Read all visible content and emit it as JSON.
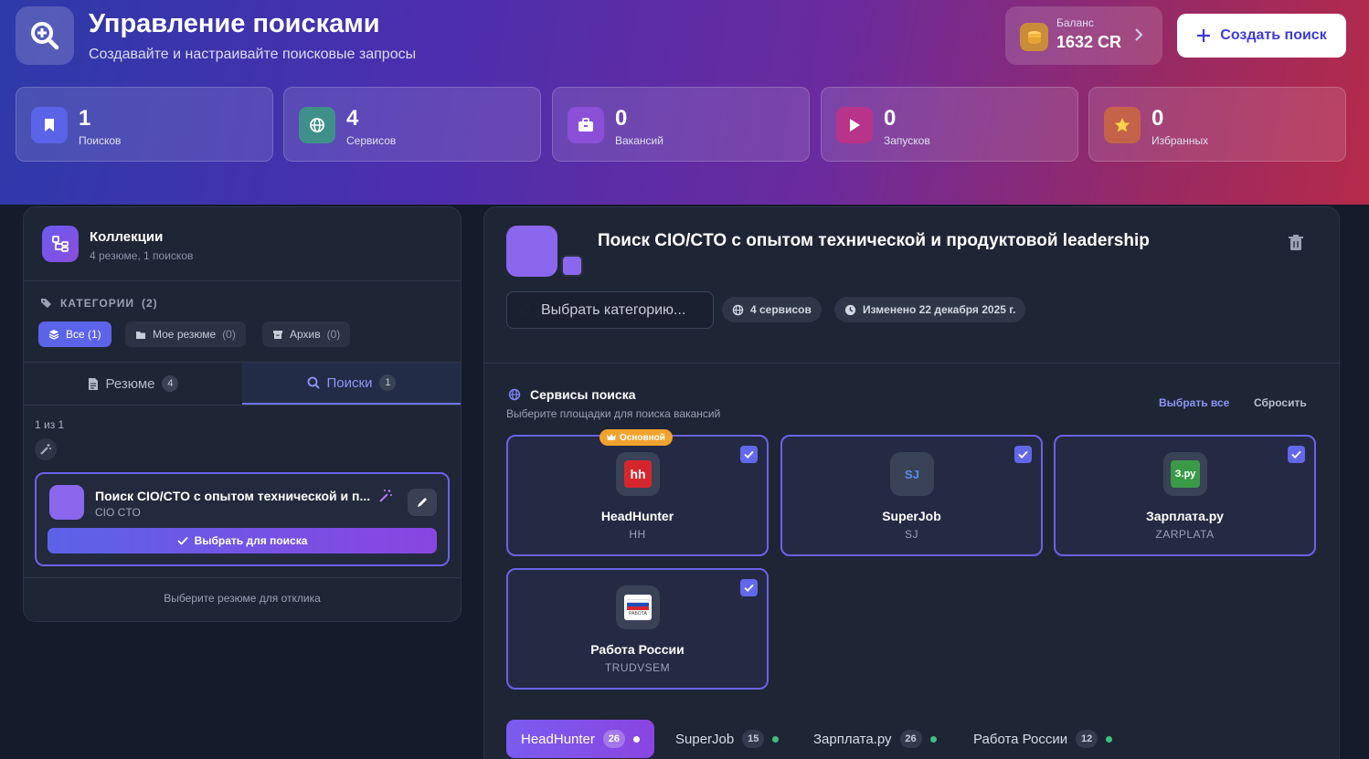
{
  "header": {
    "title": "Управление поисками",
    "subtitle": "Создавайте и настраивайте поисковые запросы",
    "balance_label": "Баланс",
    "balance_value": "1632 CR",
    "create_label": "Создать поиск"
  },
  "stats": [
    {
      "value": "1",
      "label": "Поисков",
      "icon": "bookmark-icon",
      "color": "#5b63e8"
    },
    {
      "value": "4",
      "label": "Сервисов",
      "icon": "globe-icon",
      "color": "#3f8f8a"
    },
    {
      "value": "0",
      "label": "Вакансий",
      "icon": "briefcase-icon",
      "color": "#8b4fd8"
    },
    {
      "value": "0",
      "label": "Запусков",
      "icon": "play-icon",
      "color": "#b8338a"
    },
    {
      "value": "0",
      "label": "Избранных",
      "icon": "star-icon",
      "color": "#c4634a"
    }
  ],
  "collections": {
    "title": "Коллекции",
    "subtitle": "4 резюме, 1 поисков",
    "categories_label": "КАТЕГОРИИ",
    "categories_count": "(2)",
    "chips": [
      {
        "label": "Все (1)",
        "icon": "layers-icon"
      },
      {
        "label": "Мое резюме",
        "count": "(0)",
        "icon": "folder-icon"
      },
      {
        "label": "Архив",
        "count": "(0)",
        "icon": "archive-icon"
      }
    ],
    "tabs": [
      {
        "label": "Резюме",
        "count": "4"
      },
      {
        "label": "Поиски",
        "count": "1"
      }
    ],
    "counter": "1 из 1",
    "card": {
      "title": "Поиск CIO/CTO с опытом технической и п...",
      "subtitle": "CIO CTO",
      "select_label": "Выбрать для поиска"
    },
    "footer": "Выберите резюме для отклика"
  },
  "detail": {
    "title": "Поиск CIO/CTO с опытом технической и продуктовой leadership",
    "category_placeholder": "Выбрать категорию...",
    "services_pill": "4 сервисов",
    "modified_pill": "Изменено 22 декабря 2025 г.",
    "services_title": "Сервисы поиска",
    "services_subtitle": "Выберите площадки для поиска вакансий",
    "select_all": "Выбрать все",
    "reset": "Сбросить",
    "main_badge": "Основной",
    "services": [
      {
        "name": "HeadHunter",
        "code": "HH",
        "logo_text": "hh",
        "logo_color": "#d6262d",
        "checked": true
      },
      {
        "name": "SuperJob",
        "code": "SJ",
        "logo_text": "SJ",
        "logo_color": "#2f3a55",
        "checked": true
      },
      {
        "name": "Зарплата.ру",
        "code": "ZARPLATA",
        "logo_text": "З.ру",
        "logo_color": "#3a9a47",
        "checked": true
      },
      {
        "name": "Работа России",
        "code": "TRUDVSEM",
        "logo_text": "РАБОТА",
        "logo_color": "#ffffff",
        "checked": true
      }
    ]
  },
  "bottom_tabs": [
    {
      "label": "HeadHunter",
      "count": "26"
    },
    {
      "label": "SuperJob",
      "count": "15"
    },
    {
      "label": "Зарплата.ру",
      "count": "26"
    },
    {
      "label": "Работа России",
      "count": "12"
    }
  ]
}
